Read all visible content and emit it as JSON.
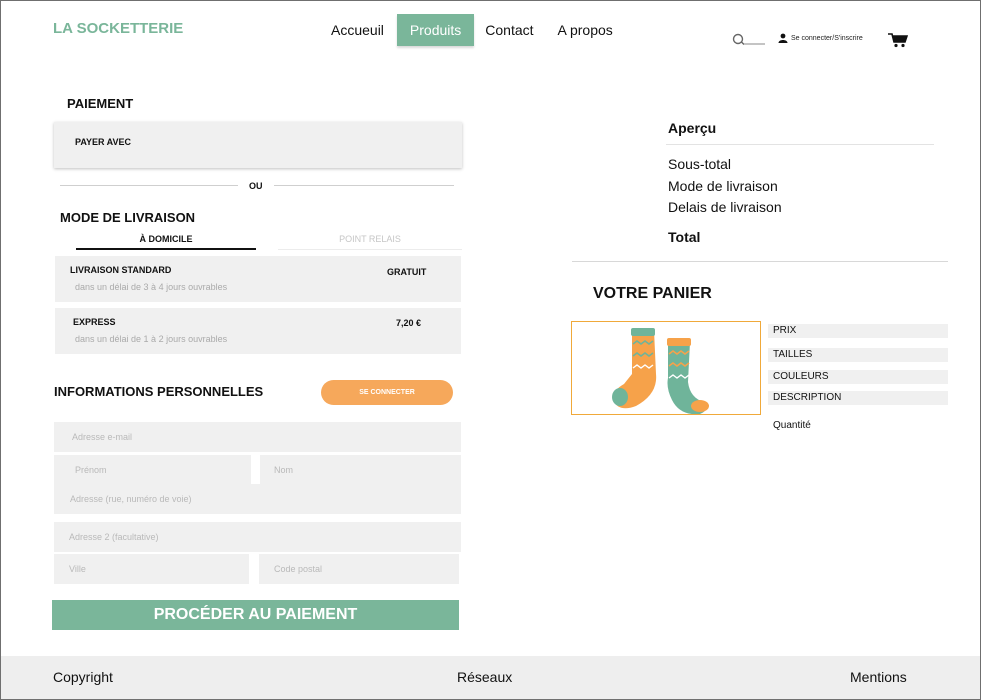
{
  "header": {
    "logo": "LA SOCKETTERIE",
    "nav": [
      "Accueuil",
      "Produits",
      "Contact",
      "A propos"
    ],
    "active_nav": "Produits",
    "auth_link": "Se connecter/S'inscrire"
  },
  "payment": {
    "title": "PAIEMENT",
    "pay_with": "PAYER AVEC",
    "separator": "OU"
  },
  "shipping": {
    "title": "MODE DE LIVRAISON",
    "tabs": [
      "À DOMICILE",
      "POINT RELAIS"
    ],
    "options": [
      {
        "name": "LIVRAISON STANDARD",
        "delay": "dans un délai de 3 à 4 jours ouvrables",
        "price": "GRATUIT"
      },
      {
        "name": "EXPRESS",
        "delay": "dans un délai de 1 à 2 jours ouvrables",
        "price": "7,20 €"
      }
    ]
  },
  "personal": {
    "title": "INFORMATIONS PERSONNELLES",
    "login_button": "SE CONNECTER",
    "fields": {
      "email": "Adresse e-mail",
      "firstname": "Prénom",
      "lastname": "Nom",
      "address": "Adresse (rue, numéro de voie)",
      "address2": "Adresse 2 (facultative)",
      "city": "Ville",
      "postal": "Code postal"
    },
    "submit": "PROCÉDER AU PAIEMENT"
  },
  "overview": {
    "title": "Aperçu",
    "lines": [
      "Sous-total",
      "Mode de livraison",
      "Delais de livraison"
    ],
    "total": "Total"
  },
  "cart": {
    "title": "VOTRE PANIER",
    "specs": [
      "PRIX",
      "TAILLES",
      "COULEURS",
      "DESCRIPTION"
    ],
    "quantity": "Quantité"
  },
  "footer": {
    "left": "Copyright",
    "center": "Réseaux",
    "right": "Mentions"
  },
  "colors": {
    "accent": "#7ab69a",
    "button_orange": "#f6a85b",
    "field_bg": "#f0f0f0",
    "sock_orange": "#f6a24a",
    "sock_green": "#6fb49a"
  }
}
